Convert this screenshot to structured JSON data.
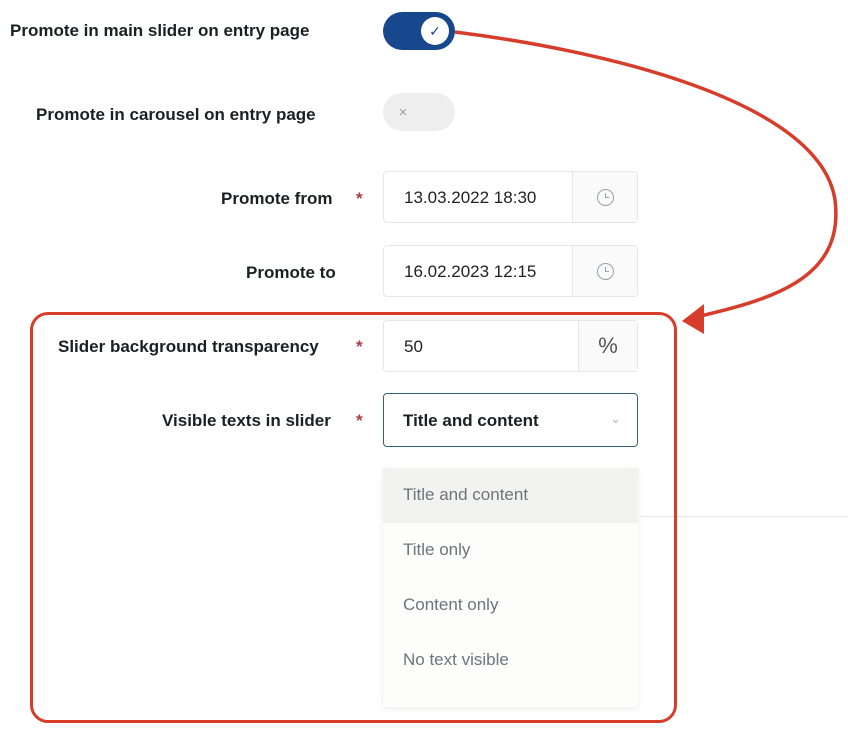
{
  "toggles": {
    "main_slider": {
      "label": "Promote in main slider on entry page",
      "state": "on",
      "icon": "check-icon",
      "glyph": "✓"
    },
    "carousel": {
      "label": "Promote in carousel on entry page",
      "state": "off",
      "icon": "x-icon",
      "glyph": "×"
    }
  },
  "promote_from": {
    "label": "Promote from",
    "required_mark": "*",
    "value": "13.03.2022 18:30",
    "icon": "clock-icon"
  },
  "promote_to": {
    "label": "Promote to",
    "value": "16.02.2023 12:15",
    "icon": "clock-icon"
  },
  "transparency": {
    "label": "Slider background transparency",
    "required_mark": "*",
    "value": "50",
    "unit": "%"
  },
  "visible_texts": {
    "label": "Visible texts in slider",
    "required_mark": "*",
    "selected": "Title and content",
    "options": [
      "Title and content",
      "Title only",
      "Content only",
      "No text visible"
    ]
  },
  "colors": {
    "toggle_on": "#17478c",
    "annotation": "#d63d2b",
    "required": "#b23a48"
  }
}
